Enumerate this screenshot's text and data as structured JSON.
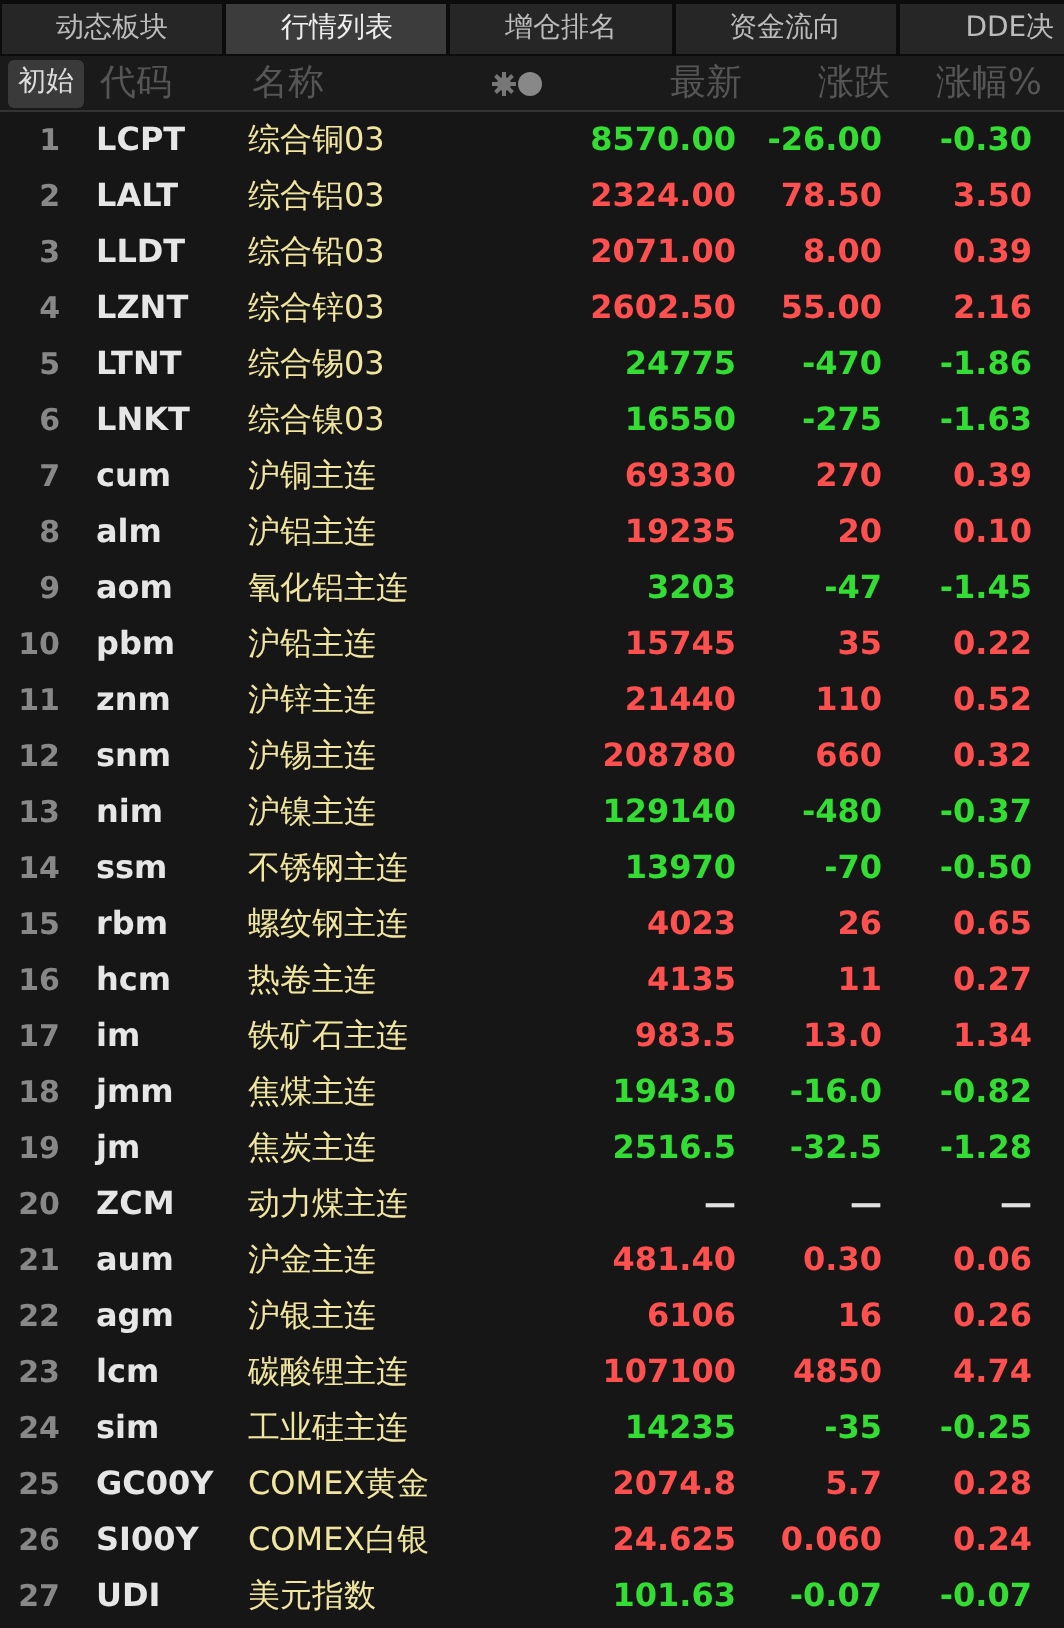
{
  "tabs": [
    {
      "label": "动态板块",
      "selected": false
    },
    {
      "label": "行情列表",
      "selected": true
    },
    {
      "label": "增仓排名",
      "selected": false
    },
    {
      "label": "资金流向",
      "selected": false
    },
    {
      "label": "DDE决",
      "selected": false
    }
  ],
  "header": {
    "reset_button": "初始",
    "columns": [
      "代码",
      "名称",
      "最新",
      "涨跌",
      "涨幅%"
    ]
  },
  "rows": [
    {
      "no": "1",
      "code": "LCPT",
      "name": "综合铜03",
      "last": "8570.00",
      "change": "-26.00",
      "pct": "-0.30",
      "color": "#33dd33"
    },
    {
      "no": "2",
      "code": "LALT",
      "name": "综合铝03",
      "last": "2324.00",
      "change": "78.50",
      "pct": "3.50",
      "color": "#ff5050"
    },
    {
      "no": "3",
      "code": "LLDT",
      "name": "综合铅03",
      "last": "2071.00",
      "change": "8.00",
      "pct": "0.39",
      "color": "#ff5050"
    },
    {
      "no": "4",
      "code": "LZNT",
      "name": "综合锌03",
      "last": "2602.50",
      "change": "55.00",
      "pct": "2.16",
      "color": "#ff5050"
    },
    {
      "no": "5",
      "code": "LTNT",
      "name": "综合锡03",
      "last": "24775",
      "change": "-470",
      "pct": "-1.86",
      "color": "#33dd33"
    },
    {
      "no": "6",
      "code": "LNKT",
      "name": "综合镍03",
      "last": "16550",
      "change": "-275",
      "pct": "-1.63",
      "color": "#33dd33"
    },
    {
      "no": "7",
      "code": "cum",
      "name": "沪铜主连",
      "last": "69330",
      "change": "270",
      "pct": "0.39",
      "color": "#ff5050"
    },
    {
      "no": "8",
      "code": "alm",
      "name": "沪铝主连",
      "last": "19235",
      "change": "20",
      "pct": "0.10",
      "color": "#ff5050"
    },
    {
      "no": "9",
      "code": "aom",
      "name": "氧化铝主连",
      "last": "3203",
      "change": "-47",
      "pct": "-1.45",
      "color": "#33dd33"
    },
    {
      "no": "10",
      "code": "pbm",
      "name": "沪铅主连",
      "last": "15745",
      "change": "35",
      "pct": "0.22",
      "color": "#ff5050"
    },
    {
      "no": "11",
      "code": "znm",
      "name": "沪锌主连",
      "last": "21440",
      "change": "110",
      "pct": "0.52",
      "color": "#ff5050"
    },
    {
      "no": "12",
      "code": "snm",
      "name": "沪锡主连",
      "last": "208780",
      "change": "660",
      "pct": "0.32",
      "color": "#ff5050"
    },
    {
      "no": "13",
      "code": "nim",
      "name": "沪镍主连",
      "last": "129140",
      "change": "-480",
      "pct": "-0.37",
      "color": "#33dd33"
    },
    {
      "no": "14",
      "code": "ssm",
      "name": "不锈钢主连",
      "last": "13970",
      "change": "-70",
      "pct": "-0.50",
      "color": "#33dd33"
    },
    {
      "no": "15",
      "code": "rbm",
      "name": "螺纹钢主连",
      "last": "4023",
      "change": "26",
      "pct": "0.65",
      "color": "#ff5050"
    },
    {
      "no": "16",
      "code": "hcm",
      "name": "热卷主连",
      "last": "4135",
      "change": "11",
      "pct": "0.27",
      "color": "#ff5050"
    },
    {
      "no": "17",
      "code": "im",
      "name": "铁矿石主连",
      "last": "983.5",
      "change": "13.0",
      "pct": "1.34",
      "color": "#ff5050"
    },
    {
      "no": "18",
      "code": "jmm",
      "name": "焦煤主连",
      "last": "1943.0",
      "change": "-16.0",
      "pct": "-0.82",
      "color": "#33dd33"
    },
    {
      "no": "19",
      "code": "jm",
      "name": "焦炭主连",
      "last": "2516.5",
      "change": "-32.5",
      "pct": "-1.28",
      "color": "#33dd33"
    },
    {
      "no": "20",
      "code": "ZCM",
      "name": "动力煤主连",
      "last": "—",
      "change": "—",
      "pct": "—",
      "color": "#e0e0e0"
    },
    {
      "no": "21",
      "code": "aum",
      "name": "沪金主连",
      "last": "481.40",
      "change": "0.30",
      "pct": "0.06",
      "color": "#ff5050"
    },
    {
      "no": "22",
      "code": "agm",
      "name": "沪银主连",
      "last": "6106",
      "change": "16",
      "pct": "0.26",
      "color": "#ff5050"
    },
    {
      "no": "23",
      "code": "lcm",
      "name": "碳酸锂主连",
      "last": "107100",
      "change": "4850",
      "pct": "4.74",
      "color": "#ff5050"
    },
    {
      "no": "24",
      "code": "sim",
      "name": "工业硅主连",
      "last": "14235",
      "change": "-35",
      "pct": "-0.25",
      "color": "#33dd33"
    },
    {
      "no": "25",
      "code": "GC00Y",
      "name": "COMEX黄金",
      "last": "2074.8",
      "change": "5.7",
      "pct": "0.28",
      "color": "#ff5050"
    },
    {
      "no": "26",
      "code": "SI00Y",
      "name": "COMEX白银",
      "last": "24.625",
      "change": "0.060",
      "pct": "0.24",
      "color": "#ff5050"
    },
    {
      "no": "27",
      "code": "UDI",
      "name": "美元指数",
      "last": "101.63",
      "change": "-0.07",
      "pct": "-0.07",
      "color": "#33dd33"
    }
  ]
}
